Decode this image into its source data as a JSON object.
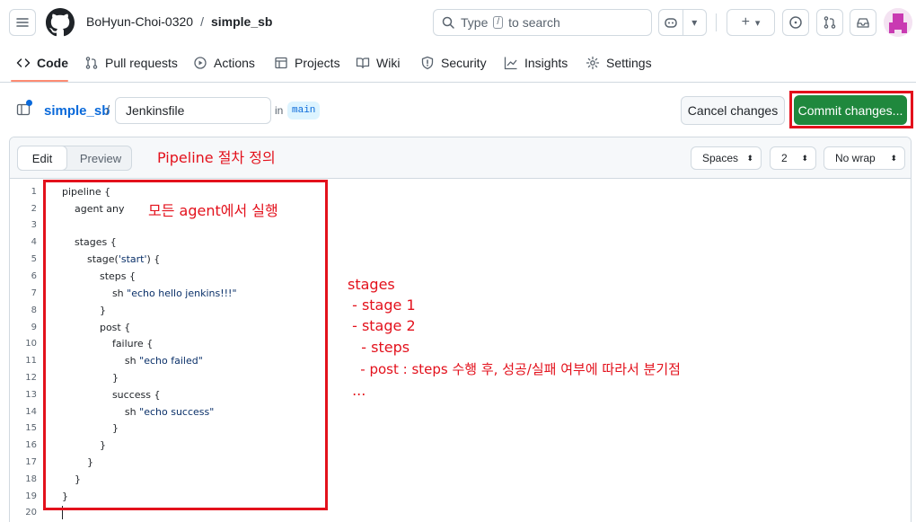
{
  "header": {
    "owner": "BoHyun-Choi-0320",
    "separator": "/",
    "repo": "simple_sb",
    "search_prefix": "Type",
    "search_key": "/",
    "search_suffix": "to search"
  },
  "tabs": [
    {
      "label": "Code",
      "icon": "code-icon",
      "active": true
    },
    {
      "label": "Pull requests",
      "icon": "git-pull-request-icon"
    },
    {
      "label": "Actions",
      "icon": "play-icon"
    },
    {
      "label": "Projects",
      "icon": "table-icon"
    },
    {
      "label": "Wiki",
      "icon": "book-icon"
    },
    {
      "label": "Security",
      "icon": "shield-icon"
    },
    {
      "label": "Insights",
      "icon": "graph-icon"
    },
    {
      "label": "Settings",
      "icon": "gear-icon"
    }
  ],
  "editor_header": {
    "repo_link": "simple_sb",
    "slash": "/",
    "filename": "Jenkinsfile",
    "in_label": "in",
    "branch": "main",
    "cancel_label": "Cancel changes",
    "commit_label": "Commit changes..."
  },
  "editor_bar": {
    "edit_label": "Edit",
    "preview_label": "Preview",
    "indent_mode": "Spaces",
    "indent_size": "2",
    "wrap_mode": "No wrap"
  },
  "code_lines": [
    {
      "num": "1",
      "text": "pipeline {"
    },
    {
      "num": "2",
      "text": "    agent any"
    },
    {
      "num": "3",
      "text": ""
    },
    {
      "num": "4",
      "text": "    stages {"
    },
    {
      "num": "5",
      "text": "        stage('start') {"
    },
    {
      "num": "6",
      "text": "            steps {"
    },
    {
      "num": "7",
      "text": "                sh \"echo hello jenkins!!!\""
    },
    {
      "num": "8",
      "text": "            }"
    },
    {
      "num": "9",
      "text": "            post {"
    },
    {
      "num": "10",
      "text": "                failure {"
    },
    {
      "num": "11",
      "text": "                    sh \"echo failed\""
    },
    {
      "num": "12",
      "text": "                }"
    },
    {
      "num": "13",
      "text": "                success {"
    },
    {
      "num": "14",
      "text": "                    sh \"echo success\""
    },
    {
      "num": "15",
      "text": "                }"
    },
    {
      "num": "16",
      "text": "            }"
    },
    {
      "num": "17",
      "text": "        }"
    },
    {
      "num": "18",
      "text": "    }"
    },
    {
      "num": "19",
      "text": "}"
    },
    {
      "num": "20",
      "text": ""
    }
  ],
  "annotations": {
    "pipeline_note": "Pipeline 절차 정의",
    "agent_note": "모든 agent에서 실행",
    "stages_note": [
      "stages",
      " - stage 1",
      " - stage 2",
      "   - steps",
      "   - post : steps 수행 후, 성공/실패 여부에 따라서 분기점",
      " ..."
    ],
    "color": "#e3111c"
  },
  "colors": {
    "commit_button": "#1f883d",
    "link": "#0969da",
    "active_tab_underline": "#fd8c73"
  }
}
